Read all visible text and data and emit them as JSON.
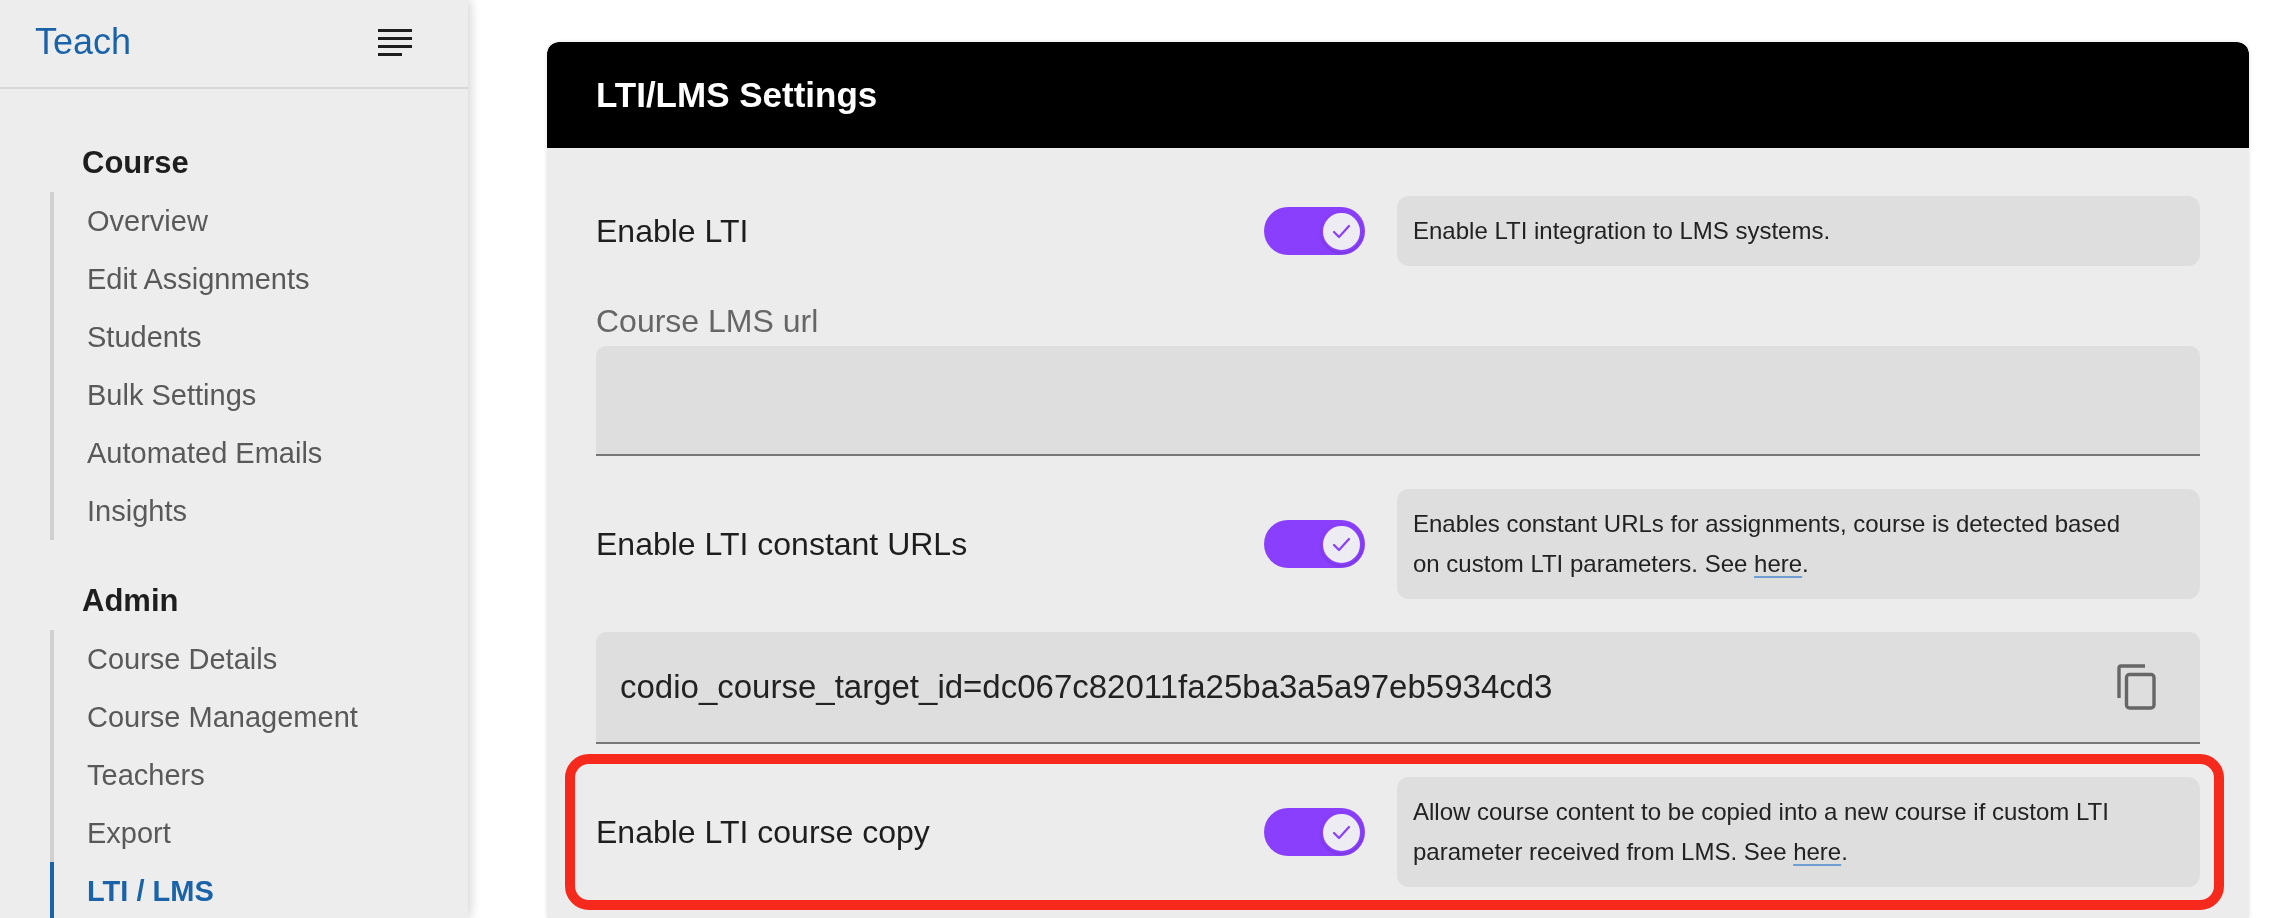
{
  "sidebar": {
    "title": "Teach",
    "sections": [
      {
        "heading": "Course",
        "items": [
          {
            "label": "Overview",
            "selected": false
          },
          {
            "label": "Edit Assignments",
            "selected": false
          },
          {
            "label": "Students",
            "selected": false
          },
          {
            "label": "Bulk Settings",
            "selected": false
          },
          {
            "label": "Automated Emails",
            "selected": false
          },
          {
            "label": "Insights",
            "selected": false
          }
        ]
      },
      {
        "heading": "Admin",
        "items": [
          {
            "label": "Course Details",
            "selected": false
          },
          {
            "label": "Course Management",
            "selected": false
          },
          {
            "label": "Teachers",
            "selected": false
          },
          {
            "label": "Export",
            "selected": false
          },
          {
            "label": "LTI / LMS",
            "selected": true
          }
        ]
      }
    ]
  },
  "panel": {
    "title": "LTI/LMS Settings",
    "settings": [
      {
        "kind": "toggle",
        "label": "Enable LTI",
        "on": true,
        "description": "Enable LTI integration to LMS systems.",
        "highlighted": false
      },
      {
        "kind": "text_field",
        "label": "Course LMS url"
      },
      {
        "kind": "toggle",
        "label": "Enable LTI constant URLs",
        "on": true,
        "description": "Enables constant URLs for assignments, course is detected based on custom LTI parameters. See",
        "link": "here",
        "after_link": ".",
        "highlighted": false
      },
      {
        "kind": "copy_field",
        "value": "codio_course_target_id=dc067c82011fa25ba3a5a97eb5934cd3"
      },
      {
        "kind": "toggle",
        "label": "Enable LTI course copy",
        "on": true,
        "description": "Allow course content to be copied into a new course if custom LTI parameter received from LMS. See",
        "link": "here",
        "after_link": ".",
        "highlighted": true
      }
    ]
  }
}
